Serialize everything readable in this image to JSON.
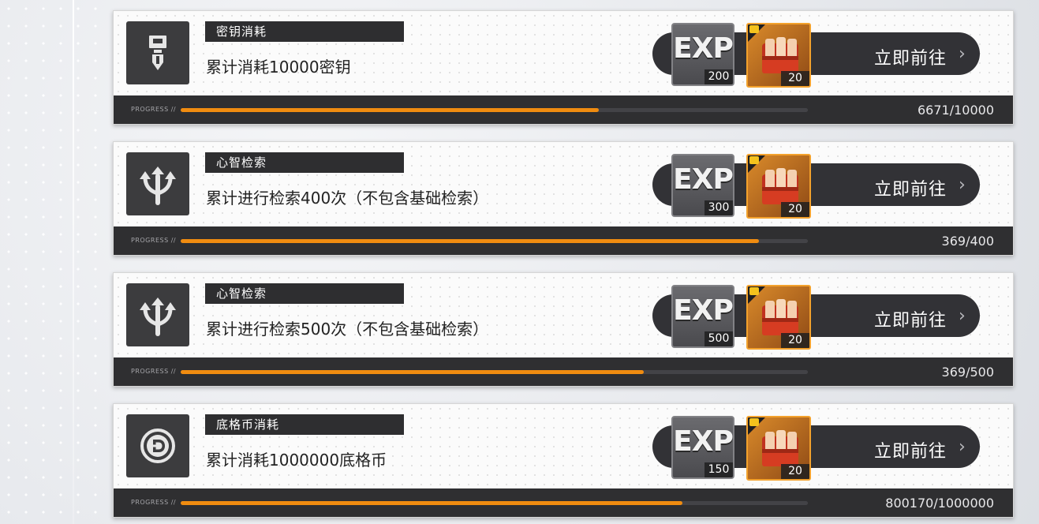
{
  "accent_color": "#f08c10",
  "quests": [
    {
      "icon": "key-icon",
      "category": "密钥消耗",
      "description": "累计消耗10000密钥",
      "rewards": {
        "exp": "200",
        "item": "20"
      },
      "go_label": "立即前往",
      "progress_label": "PROGRESS //",
      "progress_text": "6671/10000",
      "progress_fraction": 0.6671
    },
    {
      "icon": "trident-icon",
      "category": "心智检索",
      "description": "累计进行检索400次（不包含基础检索）",
      "rewards": {
        "exp": "300",
        "item": "20"
      },
      "go_label": "立即前往",
      "progress_label": "PROGRESS //",
      "progress_text": "369/400",
      "progress_fraction": 0.9225
    },
    {
      "icon": "trident-icon",
      "category": "心智检索",
      "description": "累计进行检索500次（不包含基础检索）",
      "rewards": {
        "exp": "500",
        "item": "20"
      },
      "go_label": "立即前往",
      "progress_label": "PROGRESS //",
      "progress_text": "369/500",
      "progress_fraction": 0.738
    },
    {
      "icon": "coin-icon",
      "category": "底格币消耗",
      "description": "累计消耗1000000底格币",
      "rewards": {
        "exp": "150",
        "item": "20"
      },
      "go_label": "立即前往",
      "progress_label": "PROGRESS //",
      "progress_text": "800170/1000000",
      "progress_fraction": 0.80017
    }
  ]
}
